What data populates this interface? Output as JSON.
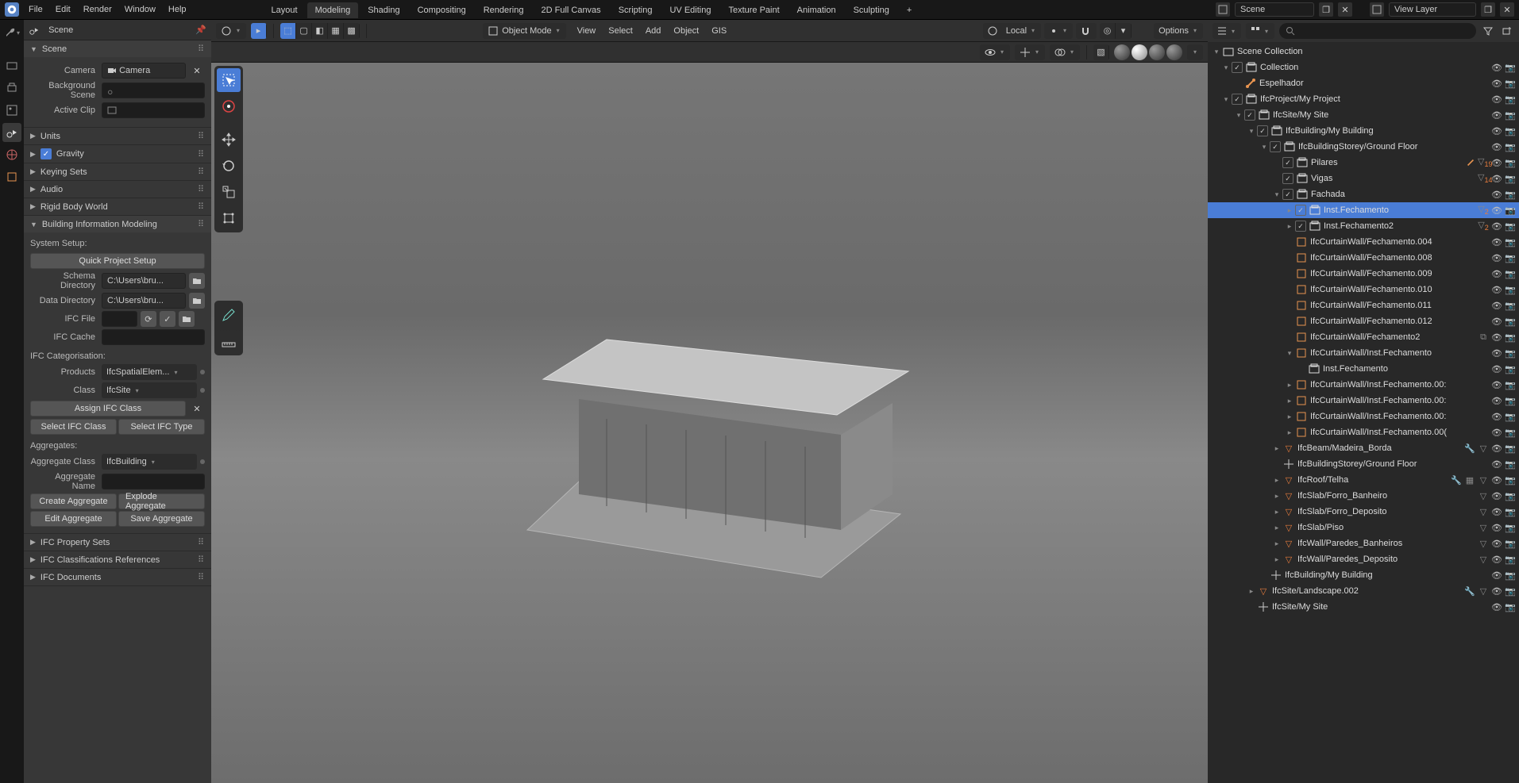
{
  "top_menu": {
    "items": [
      "File",
      "Edit",
      "Render",
      "Window",
      "Help"
    ]
  },
  "workspaces": {
    "items": [
      "Layout",
      "Modeling",
      "Shading",
      "Compositing",
      "Rendering",
      "2D Full Canvas",
      "Scripting",
      "UV Editing",
      "Texture Paint",
      "Animation",
      "Sculpting"
    ],
    "active": "Modeling",
    "plus": "+"
  },
  "top_right": {
    "scene_label": "Scene",
    "viewlayer_label": "View Layer"
  },
  "viewport_header": {
    "mode": "Object Mode",
    "menus": [
      "View",
      "Select",
      "Add",
      "Object",
      "GIS"
    ],
    "orientation": "Local",
    "options": "Options"
  },
  "props_header": {
    "breadcrumb": "Scene"
  },
  "scene_panel": {
    "title": "Scene",
    "camera_label": "Camera",
    "camera_value": "Camera",
    "bg_scene_label": "Background Scene",
    "active_clip_label": "Active Clip"
  },
  "collapsed_panels": [
    "Units",
    "Gravity",
    "Keying Sets",
    "Audio",
    "Rigid Body World"
  ],
  "gravity_checked": true,
  "bim_panel": {
    "title": "Building Information Modeling",
    "system_setup": "System Setup:",
    "quick_setup": "Quick Project Setup",
    "schema_dir_label": "Schema Directory",
    "schema_dir_value": "C:\\Users\\bru...",
    "data_dir_label": "Data Directory",
    "data_dir_value": "C:\\Users\\bru...",
    "ifc_file_label": "IFC File",
    "ifc_cache_label": "IFC Cache",
    "ifc_categorisation": "IFC Categorisation:",
    "products_label": "Products",
    "products_value": "IfcSpatialElem...",
    "class_label": "Class",
    "class_value": "IfcSite",
    "assign_ifc": "Assign IFC Class",
    "select_ifc_class": "Select IFC Class",
    "select_ifc_type": "Select IFC Type",
    "aggregates": "Aggregates:",
    "agg_class_label": "Aggregate Class",
    "agg_class_value": "IfcBuilding",
    "agg_name_label": "Aggregate Name",
    "create_agg": "Create Aggregate",
    "explode_agg": "Explode Aggregate",
    "edit_agg": "Edit Aggregate",
    "save_agg": "Save Aggregate"
  },
  "more_panels": [
    "IFC Property Sets",
    "IFC Classifications References",
    "IFC Documents"
  ],
  "outliner": {
    "root": "Scene Collection",
    "tree": [
      {
        "d": 1,
        "exp": "▾",
        "chk": true,
        "ic": "col",
        "name": "Collection"
      },
      {
        "d": 2,
        "exp": "",
        "chk": null,
        "ic": "bone",
        "name": "Espelhador",
        "trail": [
          "eye",
          "cam"
        ]
      },
      {
        "d": 1,
        "exp": "▾",
        "chk": true,
        "ic": "col",
        "name": "IfcProject/My Project"
      },
      {
        "d": 2,
        "exp": "▾",
        "chk": true,
        "ic": "col",
        "name": "IfcSite/My Site"
      },
      {
        "d": 3,
        "exp": "▾",
        "chk": true,
        "ic": "col",
        "name": "IfcBuilding/My Building"
      },
      {
        "d": 4,
        "exp": "▾",
        "chk": true,
        "ic": "col",
        "name": "IfcBuildingStorey/Ground Floor"
      },
      {
        "d": 5,
        "exp": "",
        "chk": true,
        "ic": "col",
        "name": "Pilares",
        "trail": [
          "bone",
          "tri19",
          "eye",
          "cam"
        ]
      },
      {
        "d": 5,
        "exp": "",
        "chk": true,
        "ic": "col",
        "name": "Vigas",
        "trail": [
          "tri14",
          "eye",
          "cam"
        ]
      },
      {
        "d": 5,
        "exp": "▾",
        "chk": true,
        "ic": "col",
        "name": "Fachada",
        "trail": [
          "eye",
          "cam"
        ]
      },
      {
        "d": 6,
        "exp": "▸",
        "chk": true,
        "ic": "col",
        "name": "Inst.Fechamento",
        "sel": true,
        "trail": [
          "tri2",
          "eye",
          "cam"
        ]
      },
      {
        "d": 6,
        "exp": "▸",
        "chk": true,
        "ic": "col",
        "name": "Inst.Fechamento2",
        "trail": [
          "tri2",
          "eye",
          "cam"
        ]
      },
      {
        "d": 6,
        "exp": "",
        "chk": null,
        "ic": "mesh",
        "name": "IfcCurtainWall/Fechamento.004",
        "trail": [
          "eye",
          "cam"
        ]
      },
      {
        "d": 6,
        "exp": "",
        "chk": null,
        "ic": "mesh",
        "name": "IfcCurtainWall/Fechamento.008",
        "trail": [
          "eye",
          "cam"
        ]
      },
      {
        "d": 6,
        "exp": "",
        "chk": null,
        "ic": "mesh",
        "name": "IfcCurtainWall/Fechamento.009",
        "trail": [
          "eye",
          "cam"
        ]
      },
      {
        "d": 6,
        "exp": "",
        "chk": null,
        "ic": "mesh",
        "name": "IfcCurtainWall/Fechamento.010",
        "trail": [
          "eye",
          "cam"
        ]
      },
      {
        "d": 6,
        "exp": "",
        "chk": null,
        "ic": "mesh",
        "name": "IfcCurtainWall/Fechamento.011",
        "trail": [
          "eye",
          "cam"
        ]
      },
      {
        "d": 6,
        "exp": "",
        "chk": null,
        "ic": "mesh",
        "name": "IfcCurtainWall/Fechamento.012",
        "trail": [
          "eye",
          "cam"
        ]
      },
      {
        "d": 6,
        "exp": "",
        "chk": null,
        "ic": "mesh",
        "name": "IfcCurtainWall/Fechamento2",
        "trail": [
          "link",
          "eye",
          "cam"
        ]
      },
      {
        "d": 6,
        "exp": "▾",
        "chk": null,
        "ic": "mesh",
        "name": "IfcCurtainWall/Inst.Fechamento",
        "trail": [
          "eye",
          "cam"
        ]
      },
      {
        "d": 7,
        "exp": "",
        "chk": null,
        "ic": "col",
        "name": "Inst.Fechamento"
      },
      {
        "d": 6,
        "exp": "▸",
        "chk": null,
        "ic": "mesh",
        "name": "IfcCurtainWall/Inst.Fechamento.00:",
        "trail": [
          "eye",
          "cam"
        ]
      },
      {
        "d": 6,
        "exp": "▸",
        "chk": null,
        "ic": "mesh",
        "name": "IfcCurtainWall/Inst.Fechamento.00:",
        "trail": [
          "eye",
          "cam"
        ]
      },
      {
        "d": 6,
        "exp": "▸",
        "chk": null,
        "ic": "mesh",
        "name": "IfcCurtainWall/Inst.Fechamento.00:",
        "trail": [
          "eye",
          "cam"
        ]
      },
      {
        "d": 6,
        "exp": "▸",
        "chk": null,
        "ic": "mesh",
        "name": "IfcCurtainWall/Inst.Fechamento.00(",
        "trail": [
          "eye",
          "cam"
        ]
      },
      {
        "d": 5,
        "exp": "▸",
        "chk": null,
        "ic": "tri",
        "name": "IfcBeam/Madeira_Borda",
        "trail": [
          "wrench",
          "mod",
          "eye",
          "cam"
        ]
      },
      {
        "d": 5,
        "exp": "",
        "chk": null,
        "ic": "empty",
        "name": "IfcBuildingStorey/Ground Floor",
        "trail": [
          "eye",
          "cam"
        ]
      },
      {
        "d": 5,
        "exp": "▸",
        "chk": null,
        "ic": "tri",
        "name": "IfcRoof/Telha",
        "trail": [
          "wrench",
          "grid",
          "mod",
          "eye",
          "cam"
        ]
      },
      {
        "d": 5,
        "exp": "▸",
        "chk": null,
        "ic": "tri",
        "name": "IfcSlab/Forro_Banheiro",
        "trail": [
          "mod",
          "eye",
          "cam"
        ]
      },
      {
        "d": 5,
        "exp": "▸",
        "chk": null,
        "ic": "tri",
        "name": "IfcSlab/Forro_Deposito",
        "trail": [
          "mod",
          "eye",
          "cam"
        ]
      },
      {
        "d": 5,
        "exp": "▸",
        "chk": null,
        "ic": "tri",
        "name": "IfcSlab/Piso",
        "trail": [
          "mod",
          "eye",
          "cam"
        ]
      },
      {
        "d": 5,
        "exp": "▸",
        "chk": null,
        "ic": "tri",
        "name": "IfcWall/Paredes_Banheiros",
        "trail": [
          "mod",
          "eye",
          "cam"
        ]
      },
      {
        "d": 5,
        "exp": "▸",
        "chk": null,
        "ic": "tri",
        "name": "IfcWall/Paredes_Deposito",
        "trail": [
          "mod",
          "eye",
          "cam"
        ]
      },
      {
        "d": 4,
        "exp": "",
        "chk": null,
        "ic": "empty",
        "name": "IfcBuilding/My Building",
        "trail": [
          "eye",
          "cam"
        ]
      },
      {
        "d": 3,
        "exp": "▸",
        "chk": null,
        "ic": "tri",
        "name": "IfcSite/Landscape.002",
        "trail": [
          "wrench",
          "mod",
          "eye",
          "cam"
        ]
      },
      {
        "d": 3,
        "exp": "",
        "chk": null,
        "ic": "empty",
        "name": "IfcSite/My Site",
        "trail": [
          "eye",
          "cam"
        ]
      }
    ]
  }
}
